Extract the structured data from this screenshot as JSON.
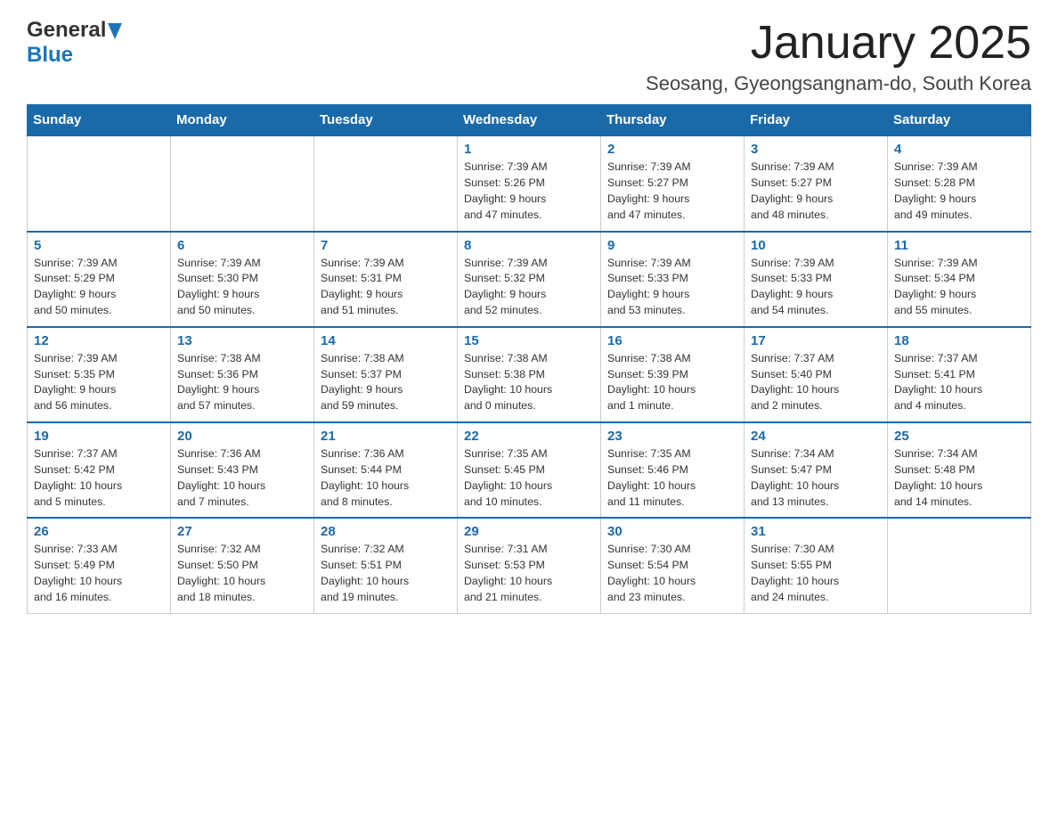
{
  "logo": {
    "general": "General",
    "blue": "Blue"
  },
  "title": "January 2025",
  "subtitle": "Seosang, Gyeongsangnam-do, South Korea",
  "days_of_week": [
    "Sunday",
    "Monday",
    "Tuesday",
    "Wednesday",
    "Thursday",
    "Friday",
    "Saturday"
  ],
  "weeks": [
    [
      {
        "day": "",
        "info": ""
      },
      {
        "day": "",
        "info": ""
      },
      {
        "day": "",
        "info": ""
      },
      {
        "day": "1",
        "info": "Sunrise: 7:39 AM\nSunset: 5:26 PM\nDaylight: 9 hours\nand 47 minutes."
      },
      {
        "day": "2",
        "info": "Sunrise: 7:39 AM\nSunset: 5:27 PM\nDaylight: 9 hours\nand 47 minutes."
      },
      {
        "day": "3",
        "info": "Sunrise: 7:39 AM\nSunset: 5:27 PM\nDaylight: 9 hours\nand 48 minutes."
      },
      {
        "day": "4",
        "info": "Sunrise: 7:39 AM\nSunset: 5:28 PM\nDaylight: 9 hours\nand 49 minutes."
      }
    ],
    [
      {
        "day": "5",
        "info": "Sunrise: 7:39 AM\nSunset: 5:29 PM\nDaylight: 9 hours\nand 50 minutes."
      },
      {
        "day": "6",
        "info": "Sunrise: 7:39 AM\nSunset: 5:30 PM\nDaylight: 9 hours\nand 50 minutes."
      },
      {
        "day": "7",
        "info": "Sunrise: 7:39 AM\nSunset: 5:31 PM\nDaylight: 9 hours\nand 51 minutes."
      },
      {
        "day": "8",
        "info": "Sunrise: 7:39 AM\nSunset: 5:32 PM\nDaylight: 9 hours\nand 52 minutes."
      },
      {
        "day": "9",
        "info": "Sunrise: 7:39 AM\nSunset: 5:33 PM\nDaylight: 9 hours\nand 53 minutes."
      },
      {
        "day": "10",
        "info": "Sunrise: 7:39 AM\nSunset: 5:33 PM\nDaylight: 9 hours\nand 54 minutes."
      },
      {
        "day": "11",
        "info": "Sunrise: 7:39 AM\nSunset: 5:34 PM\nDaylight: 9 hours\nand 55 minutes."
      }
    ],
    [
      {
        "day": "12",
        "info": "Sunrise: 7:39 AM\nSunset: 5:35 PM\nDaylight: 9 hours\nand 56 minutes."
      },
      {
        "day": "13",
        "info": "Sunrise: 7:38 AM\nSunset: 5:36 PM\nDaylight: 9 hours\nand 57 minutes."
      },
      {
        "day": "14",
        "info": "Sunrise: 7:38 AM\nSunset: 5:37 PM\nDaylight: 9 hours\nand 59 minutes."
      },
      {
        "day": "15",
        "info": "Sunrise: 7:38 AM\nSunset: 5:38 PM\nDaylight: 10 hours\nand 0 minutes."
      },
      {
        "day": "16",
        "info": "Sunrise: 7:38 AM\nSunset: 5:39 PM\nDaylight: 10 hours\nand 1 minute."
      },
      {
        "day": "17",
        "info": "Sunrise: 7:37 AM\nSunset: 5:40 PM\nDaylight: 10 hours\nand 2 minutes."
      },
      {
        "day": "18",
        "info": "Sunrise: 7:37 AM\nSunset: 5:41 PM\nDaylight: 10 hours\nand 4 minutes."
      }
    ],
    [
      {
        "day": "19",
        "info": "Sunrise: 7:37 AM\nSunset: 5:42 PM\nDaylight: 10 hours\nand 5 minutes."
      },
      {
        "day": "20",
        "info": "Sunrise: 7:36 AM\nSunset: 5:43 PM\nDaylight: 10 hours\nand 7 minutes."
      },
      {
        "day": "21",
        "info": "Sunrise: 7:36 AM\nSunset: 5:44 PM\nDaylight: 10 hours\nand 8 minutes."
      },
      {
        "day": "22",
        "info": "Sunrise: 7:35 AM\nSunset: 5:45 PM\nDaylight: 10 hours\nand 10 minutes."
      },
      {
        "day": "23",
        "info": "Sunrise: 7:35 AM\nSunset: 5:46 PM\nDaylight: 10 hours\nand 11 minutes."
      },
      {
        "day": "24",
        "info": "Sunrise: 7:34 AM\nSunset: 5:47 PM\nDaylight: 10 hours\nand 13 minutes."
      },
      {
        "day": "25",
        "info": "Sunrise: 7:34 AM\nSunset: 5:48 PM\nDaylight: 10 hours\nand 14 minutes."
      }
    ],
    [
      {
        "day": "26",
        "info": "Sunrise: 7:33 AM\nSunset: 5:49 PM\nDaylight: 10 hours\nand 16 minutes."
      },
      {
        "day": "27",
        "info": "Sunrise: 7:32 AM\nSunset: 5:50 PM\nDaylight: 10 hours\nand 18 minutes."
      },
      {
        "day": "28",
        "info": "Sunrise: 7:32 AM\nSunset: 5:51 PM\nDaylight: 10 hours\nand 19 minutes."
      },
      {
        "day": "29",
        "info": "Sunrise: 7:31 AM\nSunset: 5:53 PM\nDaylight: 10 hours\nand 21 minutes."
      },
      {
        "day": "30",
        "info": "Sunrise: 7:30 AM\nSunset: 5:54 PM\nDaylight: 10 hours\nand 23 minutes."
      },
      {
        "day": "31",
        "info": "Sunrise: 7:30 AM\nSunset: 5:55 PM\nDaylight: 10 hours\nand 24 minutes."
      },
      {
        "day": "",
        "info": ""
      }
    ]
  ]
}
